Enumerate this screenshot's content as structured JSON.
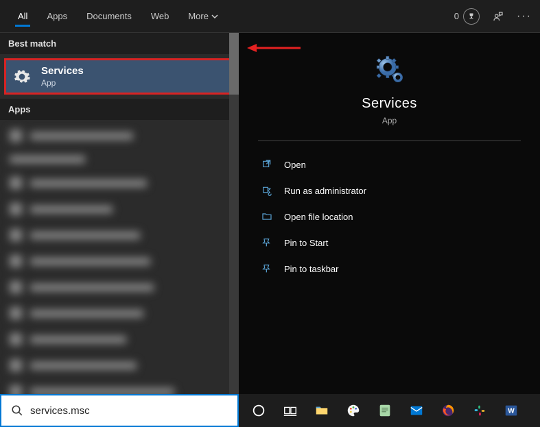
{
  "topbar": {
    "tabs": [
      {
        "label": "All",
        "active": true
      },
      {
        "label": "Apps",
        "active": false
      },
      {
        "label": "Documents",
        "active": false
      },
      {
        "label": "Web",
        "active": false
      },
      {
        "label": "More",
        "active": false,
        "has_dropdown": true
      }
    ],
    "points": "0"
  },
  "left": {
    "best_match_header": "Best match",
    "best_match": {
      "title": "Services",
      "subtitle": "App"
    },
    "apps_header": "Apps"
  },
  "preview": {
    "title": "Services",
    "subtitle": "App",
    "actions": [
      {
        "icon": "open",
        "label": "Open"
      },
      {
        "icon": "admin",
        "label": "Run as administrator"
      },
      {
        "icon": "folder",
        "label": "Open file location"
      },
      {
        "icon": "pin",
        "label": "Pin to Start"
      },
      {
        "icon": "pin",
        "label": "Pin to taskbar"
      }
    ]
  },
  "search": {
    "value": "services.msc"
  },
  "taskbar_icons": [
    "cortana",
    "task-view",
    "explorer",
    "paint",
    "notepadpp",
    "mail",
    "firefox",
    "slack",
    "word"
  ]
}
